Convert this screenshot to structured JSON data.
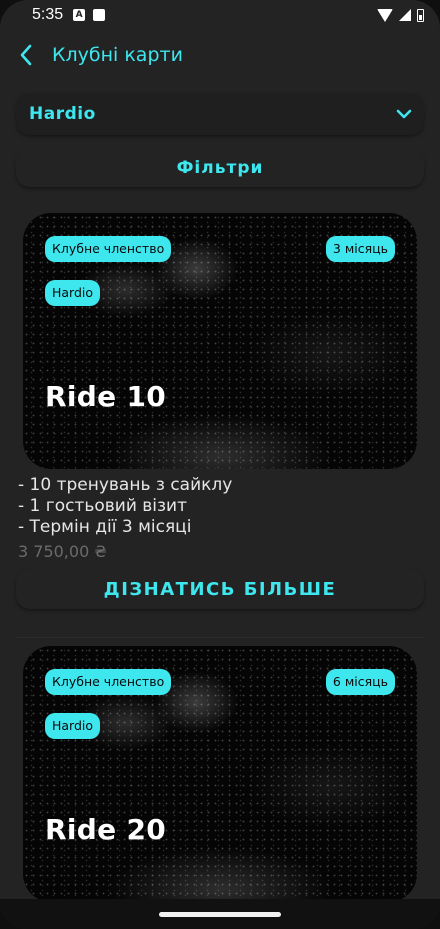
{
  "status_bar": {
    "time": "5:35",
    "icon_a": "A"
  },
  "header": {
    "title": "Клубні карти"
  },
  "club_select": {
    "value": "Hardio"
  },
  "filters": {
    "label": "Фільтри"
  },
  "cards": [
    {
      "tag_type": "Клубне членство",
      "tag_duration": "3 місяць",
      "tag_club": "Hardio",
      "name": "Ride 10",
      "lines": [
        "- 10 тренувань з сайклу",
        "- 1 гостьовий візит",
        "- Термін дії 3 місяці"
      ],
      "price": "3 750,00 ₴",
      "button": "ДІЗНАТИСЬ БІЛЬШЕ"
    },
    {
      "tag_type": "Клубне членство",
      "tag_duration": "6 місяць",
      "tag_club": "Hardio",
      "name": "Ride 20"
    }
  ],
  "colors": {
    "accent": "#3ee6ee",
    "background": "#232324",
    "card": "#050505"
  }
}
